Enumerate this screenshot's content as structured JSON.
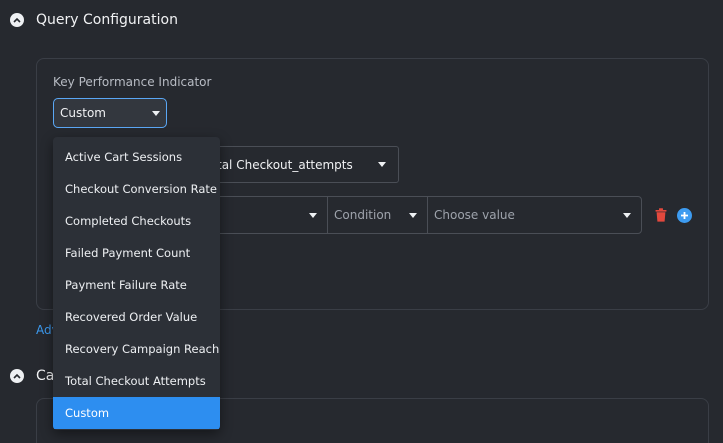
{
  "query_config": {
    "title": "Query Configuration",
    "kpi_label": "Key Performance Indicator",
    "kpi_value": "Custom"
  },
  "metric": {
    "value_visible": "tal Checkout_attempts"
  },
  "filter": {
    "condition_placeholder": "Condition",
    "value_placeholder": "Choose value"
  },
  "advanced_link": "Adv",
  "second_section": {
    "title_partial": "Ca"
  },
  "kpi_dropdown": {
    "options": [
      "Active Cart Sessions",
      "Checkout Conversion Rate",
      "Completed Checkouts",
      "Failed Payment Count",
      "Payment Failure Rate",
      "Recovered Order Value",
      "Recovery Campaign Reach",
      "Total Checkout Attempts",
      "Custom"
    ],
    "selected": "Custom"
  },
  "colors": {
    "accent": "#2d8ef0",
    "delete": "#e2483d",
    "background": "#26292f"
  }
}
